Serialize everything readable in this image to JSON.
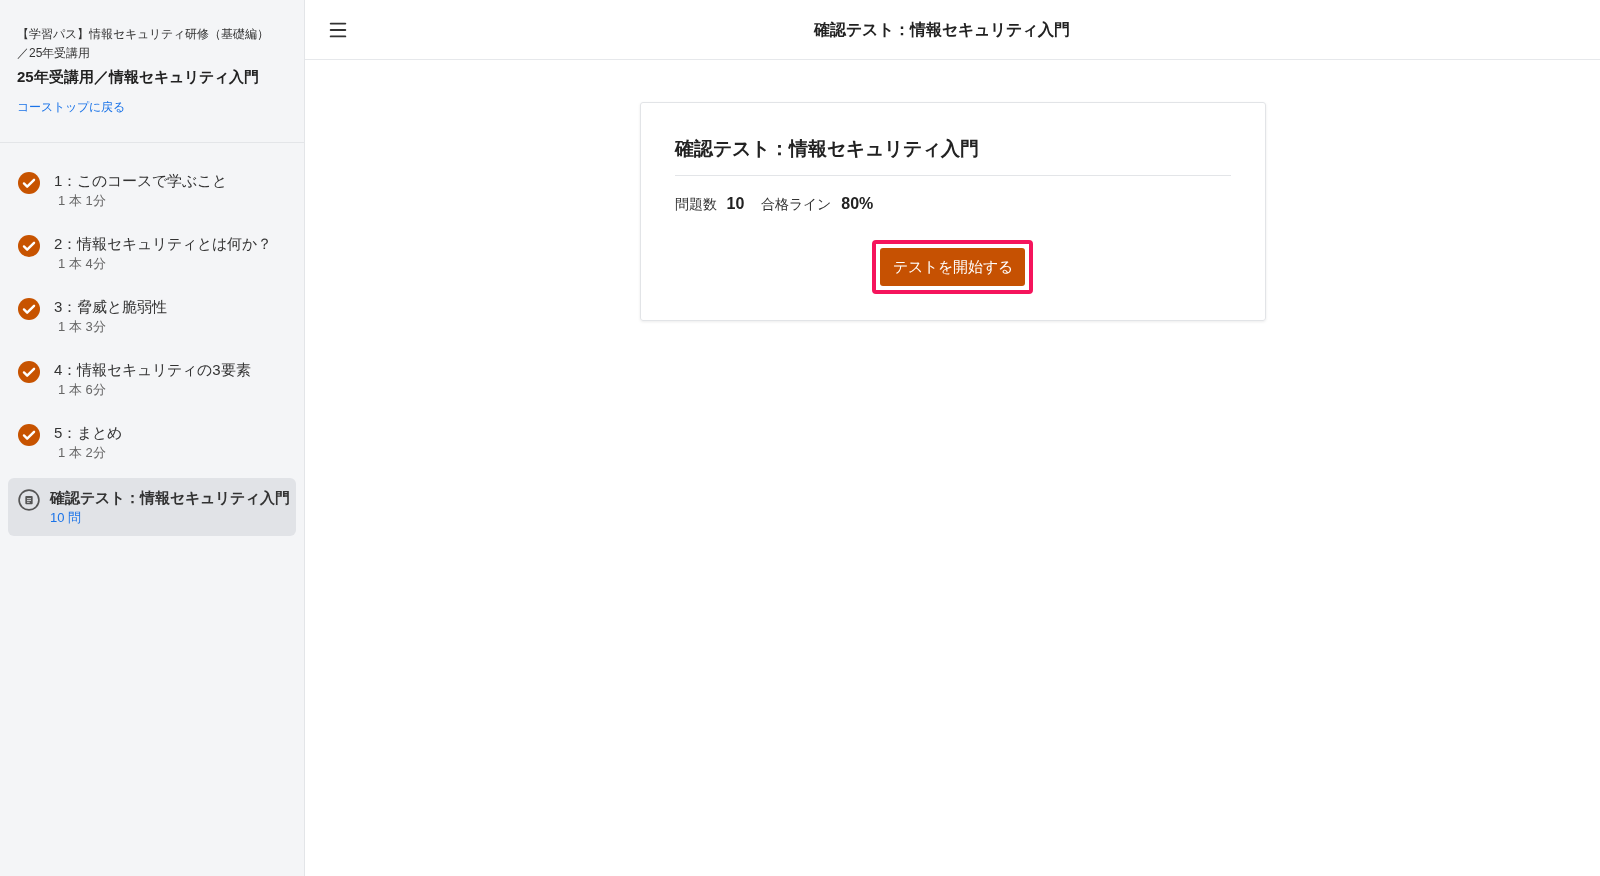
{
  "sidebar": {
    "breadcrumb": "【学習パス】情報セキュリティ研修（基礎編）／25年受講用",
    "course_title": "25年受講用／情報セキュリティ入門",
    "back_link": "コーストップに戻る",
    "items": [
      {
        "kind": "lesson",
        "title": "1：このコースで学ぶこと",
        "meta": "1 本 1分",
        "completed": true,
        "selected": false
      },
      {
        "kind": "lesson",
        "title": "2：情報セキュリティとは何か？",
        "meta": "1 本 4分",
        "completed": true,
        "selected": false
      },
      {
        "kind": "lesson",
        "title": "3：脅威と脆弱性",
        "meta": "1 本 3分",
        "completed": true,
        "selected": false
      },
      {
        "kind": "lesson",
        "title": "4：情報セキュリティの3要素",
        "meta": "1 本 6分",
        "completed": true,
        "selected": false
      },
      {
        "kind": "lesson",
        "title": "5：まとめ",
        "meta": "1 本 2分",
        "completed": true,
        "selected": false
      },
      {
        "kind": "test",
        "title": "確認テスト：情報セキュリティ入門",
        "meta": "10 問",
        "completed": false,
        "selected": true
      }
    ]
  },
  "header": {
    "title": "確認テスト：情報セキュリティ入門"
  },
  "test_card": {
    "title": "確認テスト：情報セキュリティ入門",
    "stats": [
      {
        "label": "問題数",
        "value": "10"
      },
      {
        "label": "合格ライン",
        "value": "80%"
      }
    ],
    "start_button": {
      "label": "テストを開始する",
      "highlighted": true
    }
  }
}
